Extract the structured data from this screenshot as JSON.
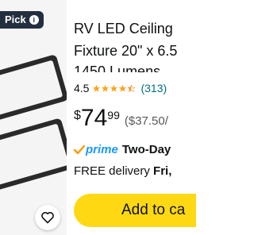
{
  "badge": {
    "label": "Pick",
    "info_icon": "info-icon"
  },
  "product": {
    "title_line1": "RV LED Ceiling",
    "title_line2": "Fixture 20\" x 6.5",
    "title_line3": "1450 Lumens",
    "rating": "4.5",
    "review_count": "(313)",
    "price_symbol": "$",
    "price_whole": "74",
    "price_fraction": "99",
    "unit_price": "($37.50/",
    "prime_label": "prime",
    "prime_speed": "Two-Day",
    "delivery_prefix": "FREE delivery",
    "delivery_day": "Fri,",
    "add_to_cart": "Add to ca"
  },
  "colors": {
    "cart_button": "#ffd814",
    "prime_blue": "#1a98ff",
    "star": "#ffa41c",
    "link": "#007185"
  }
}
